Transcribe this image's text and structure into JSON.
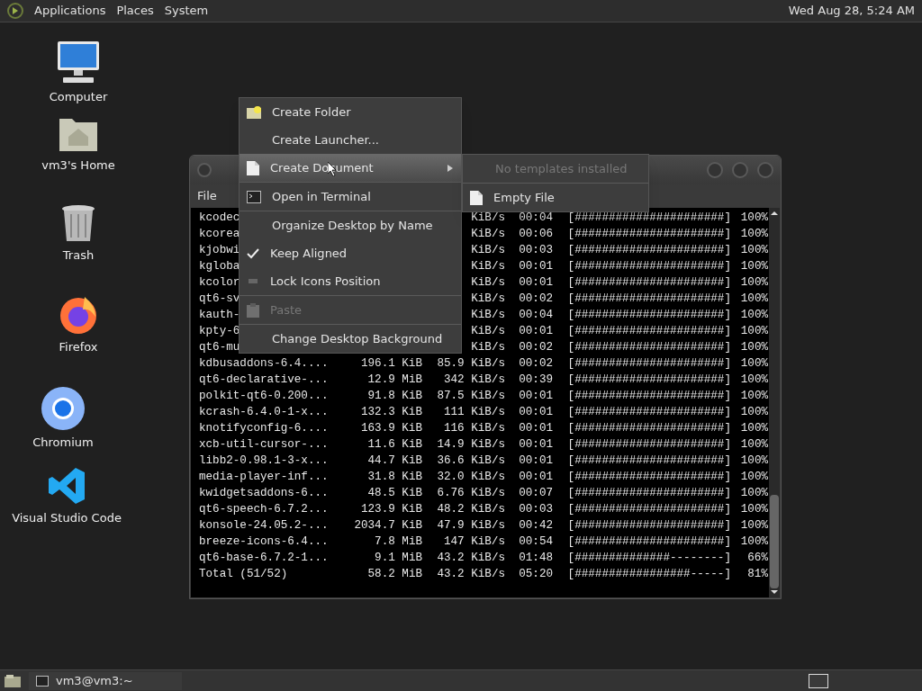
{
  "top_panel": {
    "menus": [
      "Applications",
      "Places",
      "System"
    ],
    "clock": "Wed Aug 28, 5:24 AM"
  },
  "desktop_icons": [
    {
      "kind": "computer",
      "label": "Computer"
    },
    {
      "kind": "home",
      "label": "vm3's Home"
    },
    {
      "kind": "trash",
      "label": "Trash"
    },
    {
      "kind": "firefox",
      "label": "Firefox"
    },
    {
      "kind": "chromium",
      "label": "Chromium"
    },
    {
      "kind": "vscode",
      "label": "Visual Studio Code"
    }
  ],
  "terminal": {
    "menus": [
      "File"
    ],
    "rows": [
      {
        "name": "kcodec",
        "speed": "KiB/s",
        "time": "00:04",
        "bar": "[######################]",
        "percent": "100%"
      },
      {
        "name": "kcorea",
        "speed": "KiB/s",
        "time": "00:06",
        "bar": "[######################]",
        "percent": "100%"
      },
      {
        "name": "kjobwi",
        "speed": "KiB/s",
        "time": "00:03",
        "bar": "[######################]",
        "percent": "100%"
      },
      {
        "name": "kgloba",
        "speed": "KiB/s",
        "time": "00:01",
        "bar": "[######################]",
        "percent": "100%"
      },
      {
        "name": "kcolor",
        "speed": "KiB/s",
        "time": "00:01",
        "bar": "[######################]",
        "percent": "100%"
      },
      {
        "name": "qt6-sv",
        "speed": "KiB/s",
        "time": "00:02",
        "bar": "[######################]",
        "percent": "100%"
      },
      {
        "name": "kauth-",
        "speed": "KiB/s",
        "time": "00:04",
        "bar": "[######################]",
        "percent": "100%"
      },
      {
        "name": "kpty-6",
        "speed": "KiB/s",
        "time": "00:01",
        "bar": "[######################]",
        "percent": "100%"
      },
      {
        "name": "qt6-mu",
        "speed": "KiB/s",
        "time": "00:02",
        "bar": "[######################]",
        "percent": "100%"
      },
      {
        "name": "kdbusaddons-6.4....",
        "size": "196.1 KiB",
        "speed": "85.9 KiB/s",
        "time": "00:02",
        "bar": "[######################]",
        "percent": "100%"
      },
      {
        "name": "qt6-declarative-...",
        "size": "12.9 MiB",
        "speed": "342 KiB/s",
        "time": "00:39",
        "bar": "[######################]",
        "percent": "100%"
      },
      {
        "name": "polkit-qt6-0.200...",
        "size": "91.8 KiB",
        "speed": "87.5 KiB/s",
        "time": "00:01",
        "bar": "[######################]",
        "percent": "100%"
      },
      {
        "name": "kcrash-6.4.0-1-x...",
        "size": "132.3 KiB",
        "speed": "111 KiB/s",
        "time": "00:01",
        "bar": "[######################]",
        "percent": "100%"
      },
      {
        "name": "knotifyconfig-6....",
        "size": "163.9 KiB",
        "speed": "116 KiB/s",
        "time": "00:01",
        "bar": "[######################]",
        "percent": "100%"
      },
      {
        "name": "xcb-util-cursor-...",
        "size": "11.6 KiB",
        "speed": "14.9 KiB/s",
        "time": "00:01",
        "bar": "[######################]",
        "percent": "100%"
      },
      {
        "name": "libb2-0.98.1-3-x...",
        "size": "44.7 KiB",
        "speed": "36.6 KiB/s",
        "time": "00:01",
        "bar": "[######################]",
        "percent": "100%"
      },
      {
        "name": "media-player-inf...",
        "size": "31.8 KiB",
        "speed": "32.0 KiB/s",
        "time": "00:01",
        "bar": "[######################]",
        "percent": "100%"
      },
      {
        "name": "kwidgetsaddons-6...",
        "size": "48.5 KiB",
        "speed": "6.76 KiB/s",
        "time": "00:07",
        "bar": "[######################]",
        "percent": "100%"
      },
      {
        "name": "qt6-speech-6.7.2...",
        "size": "123.9 KiB",
        "speed": "48.2 KiB/s",
        "time": "00:03",
        "bar": "[######################]",
        "percent": "100%"
      },
      {
        "name": "konsole-24.05.2-...",
        "size": "2034.7 KiB",
        "speed": "47.9 KiB/s",
        "time": "00:42",
        "bar": "[######################]",
        "percent": "100%"
      },
      {
        "name": "breeze-icons-6.4...",
        "size": "7.8 MiB",
        "speed": "147 KiB/s",
        "time": "00:54",
        "bar": "[######################]",
        "percent": "100%"
      },
      {
        "name": "qt6-base-6.7.2-1...",
        "size": "9.1 MiB",
        "speed": "43.2 KiB/s",
        "time": "01:48",
        "bar": "[##############--------]",
        "percent": "66%"
      },
      {
        "name": "Total (51/52)",
        "size": "58.2 MiB",
        "speed": "43.2 KiB/s",
        "time": "05:20",
        "bar": "[#################-----]",
        "percent": "81%"
      }
    ]
  },
  "context_menu": {
    "items": [
      {
        "kind": "action",
        "label": "Create Folder",
        "disabled": false
      },
      {
        "kind": "action",
        "label": "Create Launcher...",
        "disabled": false
      },
      {
        "kind": "submenu",
        "label": "Create Document",
        "disabled": false,
        "selected": true
      },
      {
        "kind": "separator"
      },
      {
        "kind": "action",
        "label": "Open in Terminal",
        "disabled": false
      },
      {
        "kind": "separator"
      },
      {
        "kind": "action",
        "label": "Organize Desktop by Name",
        "disabled": false
      },
      {
        "kind": "check",
        "label": "Keep Aligned",
        "checked": true
      },
      {
        "kind": "check",
        "label": "Lock Icons Position",
        "checked": false
      },
      {
        "kind": "separator"
      },
      {
        "kind": "action",
        "label": "Paste",
        "disabled": true
      },
      {
        "kind": "separator"
      },
      {
        "kind": "action",
        "label": "Change Desktop Background",
        "disabled": false
      }
    ]
  },
  "submenu": {
    "items": [
      {
        "kind": "action",
        "label": "No templates installed",
        "disabled": true
      },
      {
        "kind": "separator"
      },
      {
        "kind": "action",
        "label": "Empty File",
        "disabled": false
      }
    ]
  },
  "bottom_panel": {
    "tasks": [
      {
        "label": "vm3@vm3:~"
      }
    ]
  }
}
